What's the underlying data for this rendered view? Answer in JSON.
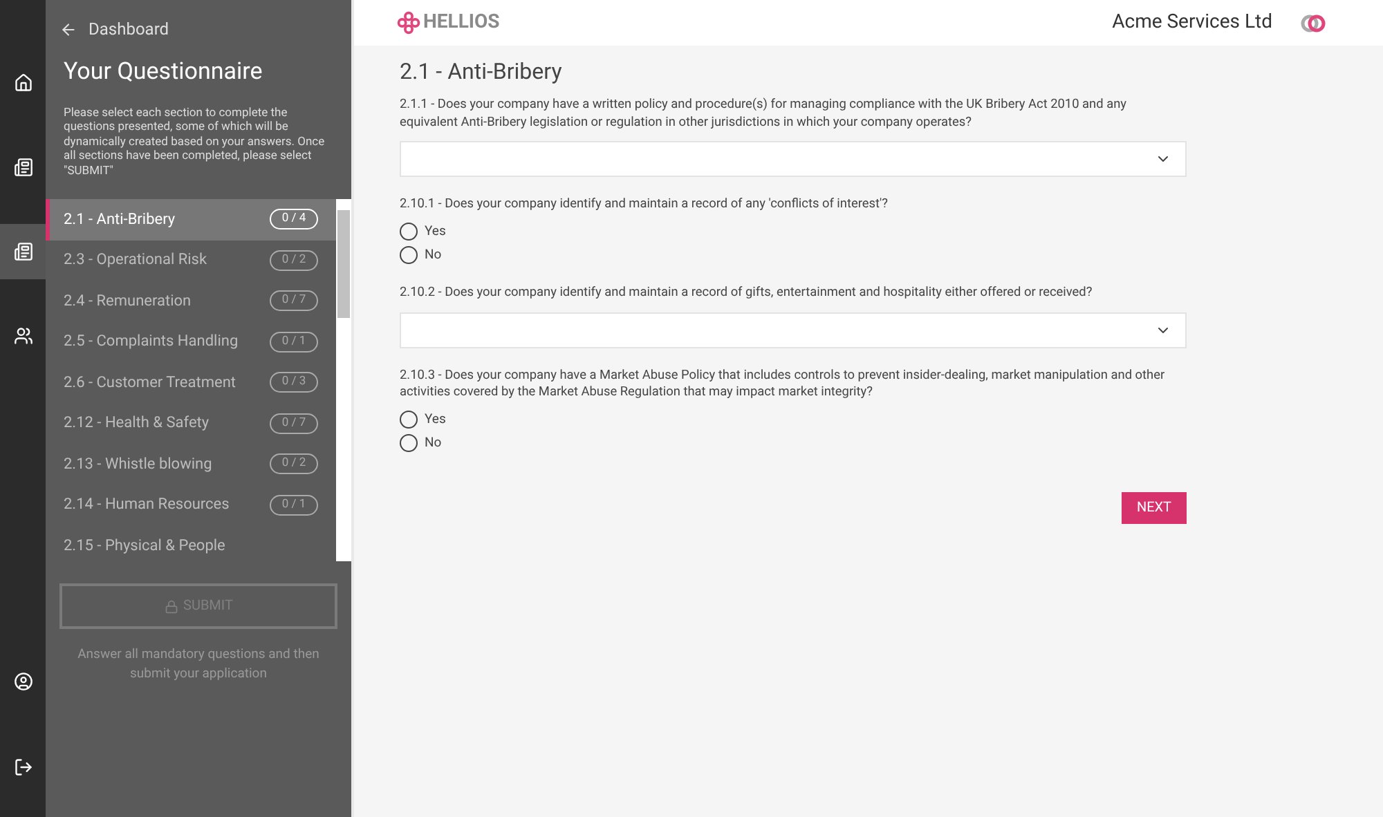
{
  "rail": [
    {
      "kind": "home",
      "selected": false
    },
    {
      "kind": "list",
      "selected": false
    },
    {
      "kind": "list",
      "selected": true
    },
    {
      "kind": "users",
      "selected": false
    }
  ],
  "rail_bottom": [
    {
      "kind": "account"
    },
    {
      "kind": "logout"
    }
  ],
  "sidebar": {
    "back": "Dashboard",
    "title": "Your Questionnaire",
    "intro": "Please select each section to complete the questions presented, some of which will be dynamically created based on your answers. Once all sections have been completed, please select \"SUBMIT\"",
    "items": [
      {
        "label": "2.1 - Anti-Bribery",
        "count": "0 / 4",
        "selected": true
      },
      {
        "label": "2.3 - Operational Risk",
        "count": "0 / 2",
        "selected": false
      },
      {
        "label": "2.4 - Remuneration",
        "count": "0 / 7",
        "selected": false
      },
      {
        "label": "2.5 - Complaints Handling",
        "count": "0 / 1",
        "selected": false
      },
      {
        "label": "2.6 - Customer Treatment",
        "count": "0 / 3",
        "selected": false
      },
      {
        "label": "2.12 - Health & Safety",
        "count": "0 / 7",
        "selected": false
      },
      {
        "label": "2.13 - Whistle blowing",
        "count": "0 / 2",
        "selected": false
      },
      {
        "label": "2.14 - Human Resources",
        "count": "0 / 1",
        "selected": false
      },
      {
        "label": "2.15 - Physical & People",
        "selected": false
      }
    ],
    "submit": {
      "label": "SUBMIT",
      "disabled": true
    },
    "hint": "Answer all mandatory questions and then submit your application"
  },
  "header": {
    "logo": "HELLIOS",
    "company": "Acme Services Ltd"
  },
  "section_title": "2.1 - Anti-Bribery",
  "questions": [
    {
      "kind": "select",
      "text": "2.1.1 - Does your company have a written policy and procedure(s) for managing compliance with the UK Bribery Act 2010 and any equivalent Anti-Bribery legislation or regulation in other jurisdictions in which your company operates?"
    },
    {
      "kind": "radio",
      "text": "2.10.1 - Does your company identify and maintain a record of any 'conflicts of interest'?",
      "options": [
        {
          "label": "Yes",
          "selected": false
        },
        {
          "label": "No",
          "selected": false
        }
      ]
    },
    {
      "kind": "select",
      "text": "2.10.2 - Does your company identify and maintain a record of gifts, entertainment and hospitality either offered or received?"
    },
    {
      "kind": "radio",
      "text": "2.10.3 - Does your company have a Market Abuse Policy that includes controls to prevent insider-dealing, market manipulation and other activities covered by the Market Abuse Regulation that may impact market integrity?",
      "options": [
        {
          "label": "Yes",
          "selected": false
        },
        {
          "label": "No",
          "selected": false
        }
      ]
    }
  ],
  "next": "NEXT"
}
